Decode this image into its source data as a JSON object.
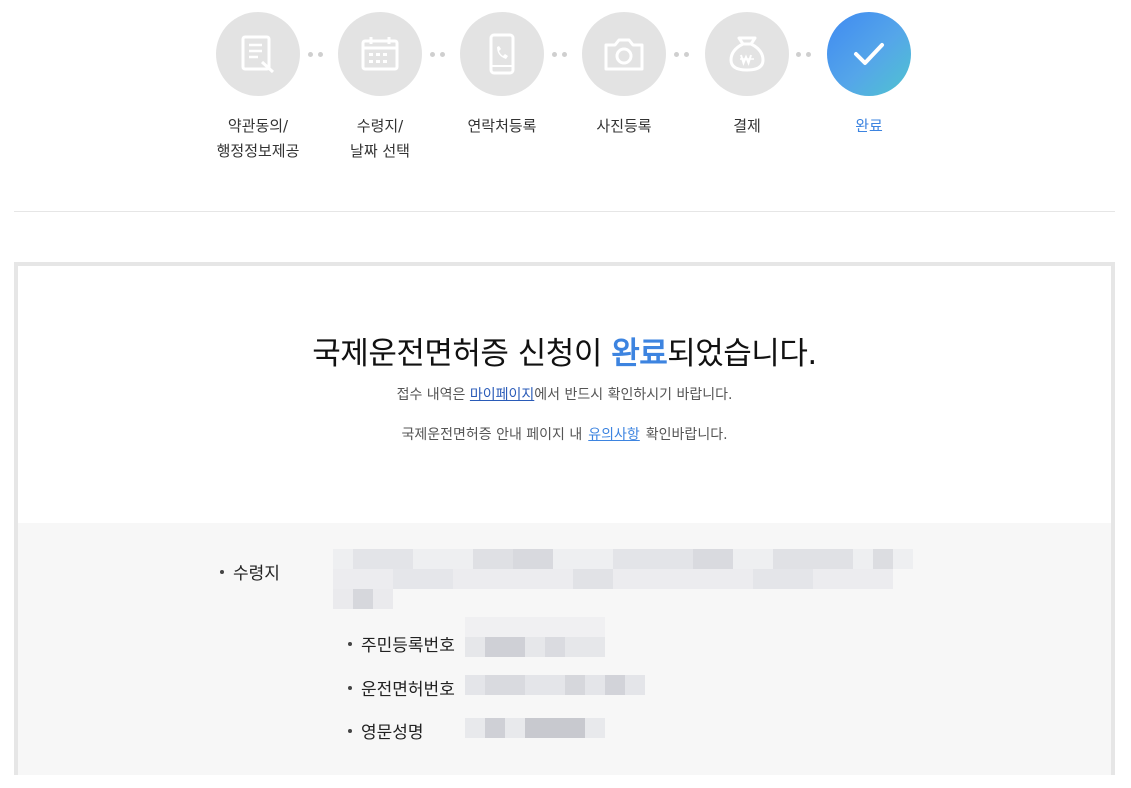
{
  "steps": [
    {
      "label": "약관동의/\n행정정보제공",
      "icon": "document-icon",
      "state": "inactive"
    },
    {
      "label": "수령지/\n날짜 선택",
      "icon": "calendar-icon",
      "state": "inactive"
    },
    {
      "label": "연락처등록",
      "icon": "phone-icon",
      "state": "inactive"
    },
    {
      "label": "사진등록",
      "icon": "camera-icon",
      "state": "inactive"
    },
    {
      "label": "결제",
      "icon": "won-money-icon",
      "state": "inactive"
    },
    {
      "label": "완료",
      "icon": "check-icon",
      "state": "active"
    }
  ],
  "result": {
    "headline_before": "국제운전면허증 신청이 ",
    "headline_highlight": "완료",
    "headline_after": "되었습니다.",
    "note1_before": "접수 내역은 ",
    "note1_link": "마이페이지",
    "note1_after": "에서 반드시 확인하시기 바랍니다.",
    "note2_before": "국제운전면허증 안내 페이지 내",
    "note2_link": "유의사항",
    "note2_after": "확인바랍니다."
  },
  "info": {
    "pickup_label": "수령지",
    "resident_label": "주민등록번호",
    "license_label": "운전면허번호",
    "english_name_label": "영문성명"
  },
  "colors": {
    "accent": "#3d84e0",
    "inactive_step": "#e3e3e3",
    "link_dark": "#2a5bb8",
    "panel_bg": "#f7f7f7"
  }
}
